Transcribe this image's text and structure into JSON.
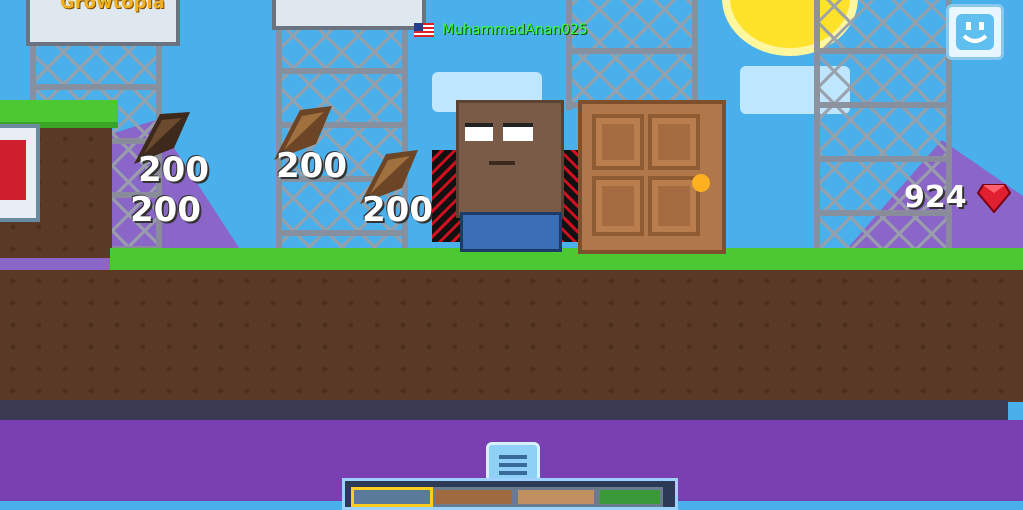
{
  "player": {
    "name": "MuhammadAnan025",
    "flag": "us-flag-icon"
  },
  "dropped_items": [
    {
      "item": "seed",
      "count": "200"
    },
    {
      "item": "seed",
      "count": "200"
    },
    {
      "item": "seed",
      "count": "200"
    },
    {
      "item": "seed",
      "count": "200"
    }
  ],
  "gems": {
    "count": "924",
    "icon": "red-gem-icon"
  },
  "billboard": {
    "text": "Growtopia"
  },
  "icons": {
    "emote": "smiley-icon",
    "menu": "hamburger-menu-icon"
  },
  "colors": {
    "sky": "#4ab0ec",
    "grass": "#4cc832",
    "dirt": "#5a3a26",
    "gem": "#e02030",
    "name_tag": "#3cff3c"
  }
}
